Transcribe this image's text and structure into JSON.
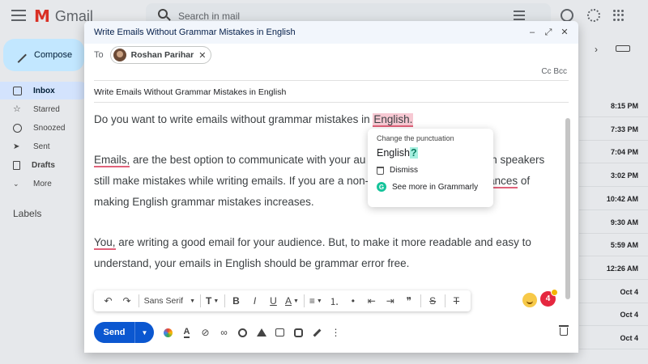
{
  "gmail": {
    "app_name": "Gmail",
    "search_placeholder": "Search in mail",
    "compose_label": "Compose",
    "sidebar": [
      {
        "label": "Inbox",
        "icon": "inbox-icon",
        "active": true
      },
      {
        "label": "Starred",
        "icon": "star-icon"
      },
      {
        "label": "Snoozed",
        "icon": "clock-icon"
      },
      {
        "label": "Sent",
        "icon": "send-icon"
      },
      {
        "label": "Drafts",
        "icon": "draft-icon"
      },
      {
        "label": "More",
        "icon": "chevron-down-icon"
      }
    ],
    "labels_heading": "Labels",
    "email_times": [
      {
        "time": "8:15 PM",
        "unread": true
      },
      {
        "time": "7:33 PM",
        "unread": true
      },
      {
        "time": "7:04 PM",
        "unread": true
      },
      {
        "time": "3:02 PM",
        "unread": true
      },
      {
        "time": "10:42 AM",
        "unread": true
      },
      {
        "time": "9:30 AM",
        "unread": true
      },
      {
        "time": "5:59 AM",
        "unread": true
      },
      {
        "time": "12:26 AM",
        "unread": true
      },
      {
        "time": "Oct 4",
        "unread": true
      },
      {
        "time": "Oct 4",
        "unread": true
      },
      {
        "time": "Oct 4",
        "unread": true
      }
    ]
  },
  "compose": {
    "title": "Write Emails Without Grammar Mistakes in English",
    "window_controls": {
      "minimize": "–",
      "expand": "⤢",
      "close": "✕"
    },
    "to_label": "To",
    "recipient": {
      "name": "Roshan Parihar",
      "remove": "✕"
    },
    "cc_bcc": "Cc Bcc",
    "subject": "Write Emails Without Grammar Mistakes in English",
    "body": {
      "p1": {
        "before": "Do you want to write emails without grammar mistakes in ",
        "flag": "English."
      },
      "p2": {
        "flag1": "Emails,",
        "mid1": " are the best option to communicate with your au",
        "mid2": "sh speakers still make mistakes while writing emails. If you are a non-",
        "flag2": "ances",
        "mid3": " of making English grammar mistakes increases."
      },
      "p3": {
        "flag1": "You,",
        "rest": " are writing a good email for your audience. But, to make it more readable and easy to understand, your emails in English should be grammar error free."
      }
    },
    "grammarly_popup": {
      "title": "Change the punctuation",
      "suggestion_word": "English",
      "suggestion_mark": "?",
      "dismiss": "Dismiss",
      "see_more": "See more in Grammarly",
      "g_letter": "G"
    },
    "format_toolbar": {
      "undo": "↶",
      "redo": "↷",
      "font": "Sans Serif",
      "size_icon": "T",
      "bold": "B",
      "italic": "I",
      "underline": "U",
      "text_color": "A",
      "align": "≡",
      "numbered": "⒈",
      "bulleted": "•",
      "indent_less": "⇤",
      "indent_more": "⇥",
      "quote": "❞",
      "strike": "S",
      "clear": "T"
    },
    "grammarly_badge_count": "4",
    "send_label": "Send",
    "more_options": "⋮"
  },
  "colors": {
    "accent": "#0b57d0",
    "grammarly_green": "#15c39a",
    "error_underline": "#e0627a",
    "badge_red": "#e5273f"
  }
}
